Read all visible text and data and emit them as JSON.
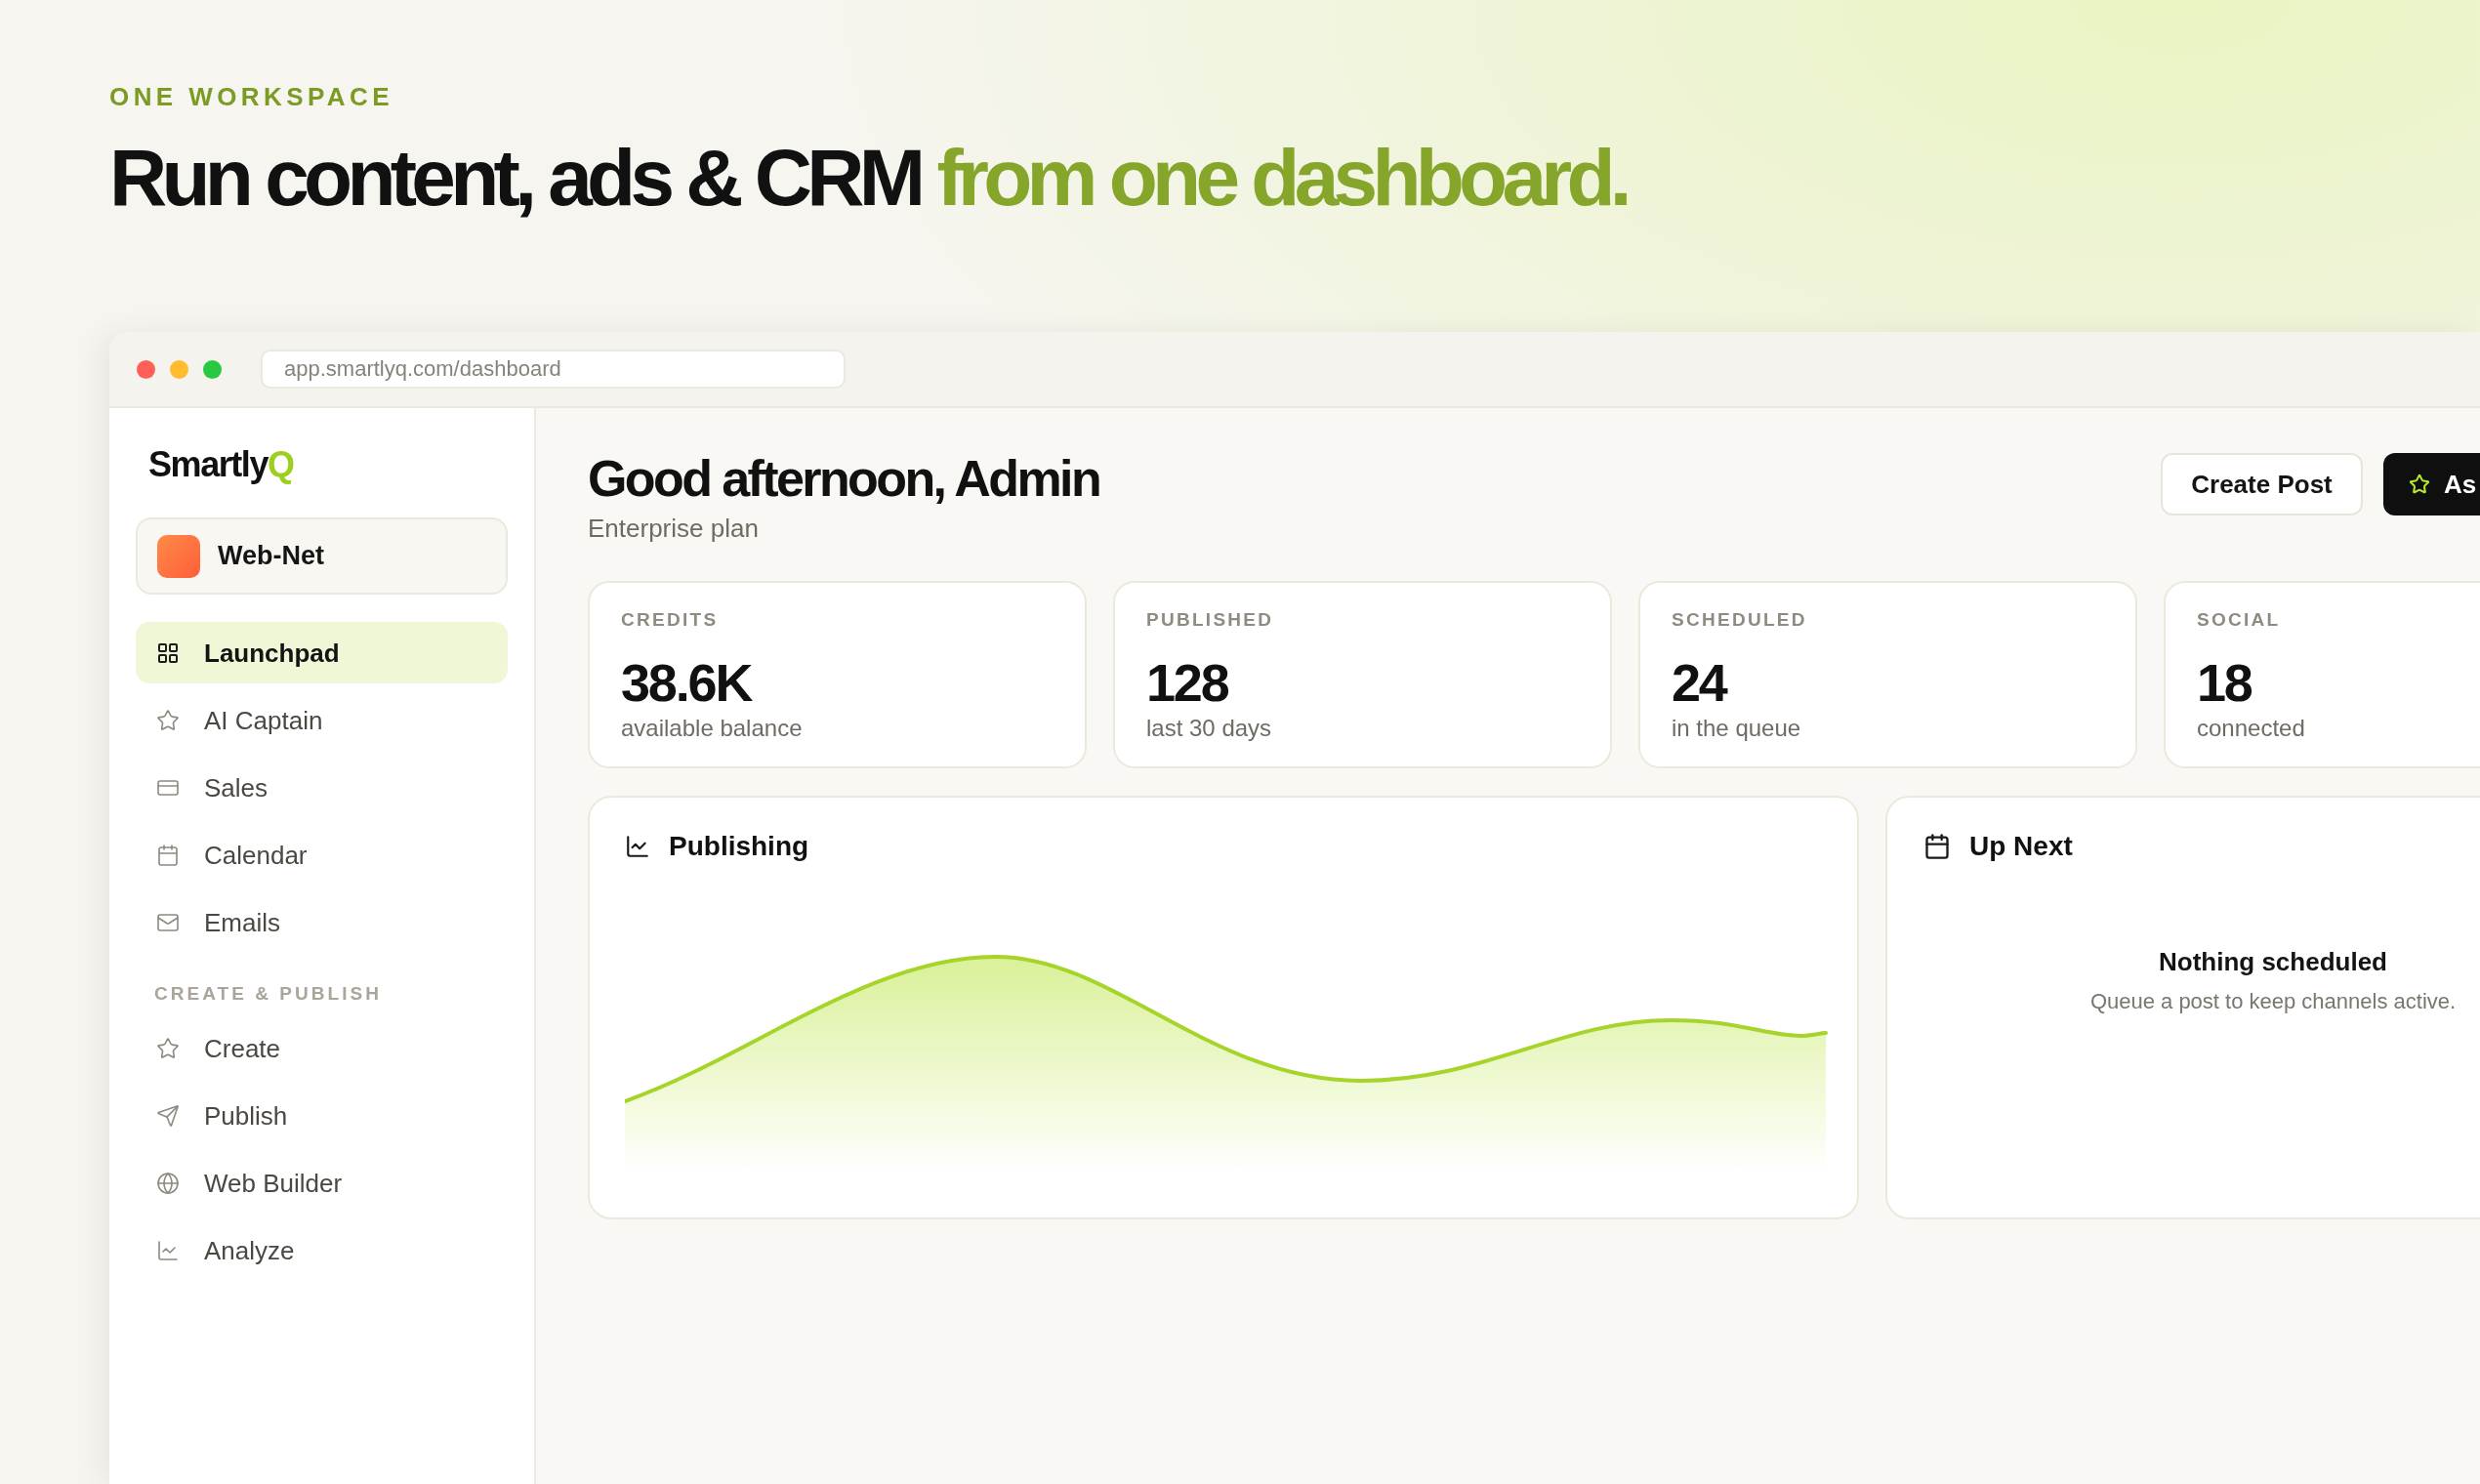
{
  "hero": {
    "eyebrow": "ONE WORKSPACE",
    "headline": [
      {
        "text": "Run content, ads & CRM",
        "accent": false
      },
      {
        "text": "from one dashboard.",
        "accent": true
      }
    ]
  },
  "browser": {
    "url": "app.smartlyq.com/dashboard"
  },
  "sidebar": {
    "logo": [
      {
        "text": "Smartly",
        "accent": false
      },
      {
        "text": "Q",
        "accent": true
      }
    ],
    "workspace": "Web-Net",
    "sections": [
      {
        "items": [
          {
            "label": "Launchpad",
            "selected": true
          },
          {
            "label": "AI Captain",
            "selected": false
          },
          {
            "label": "Sales",
            "selected": false
          },
          {
            "label": "Calendar",
            "selected": false
          },
          {
            "label": "Emails",
            "selected": false
          }
        ]
      },
      {
        "title": "CREATE & PUBLISH",
        "items": [
          {
            "label": "Create",
            "selected": false
          },
          {
            "label": "Publish",
            "selected": false
          },
          {
            "label": "Web Builder",
            "selected": false
          },
          {
            "label": "Analyze",
            "selected": false
          }
        ]
      }
    ]
  },
  "header": {
    "greeting": "Good afternoon, Admin",
    "plan": "Enterprise plan",
    "actions": [
      {
        "label": "Create Post",
        "kind": "outline"
      },
      {
        "label": "As",
        "kind": "primary"
      }
    ]
  },
  "stats": [
    {
      "label": "CREDITS",
      "value": "38.6K",
      "caption": "available balance"
    },
    {
      "label": "PUBLISHED",
      "value": "128",
      "caption": "last 30 days"
    },
    {
      "label": "SCHEDULED",
      "value": "24",
      "caption": "in the queue"
    },
    {
      "label": "SOCIAL",
      "value": "18",
      "caption": "connected"
    }
  ],
  "publishing": {
    "title": "Publishing"
  },
  "up_next": {
    "title": "Up Next",
    "empty_title": "Nothing scheduled",
    "empty_text": "Queue a post to keep channels active."
  }
}
